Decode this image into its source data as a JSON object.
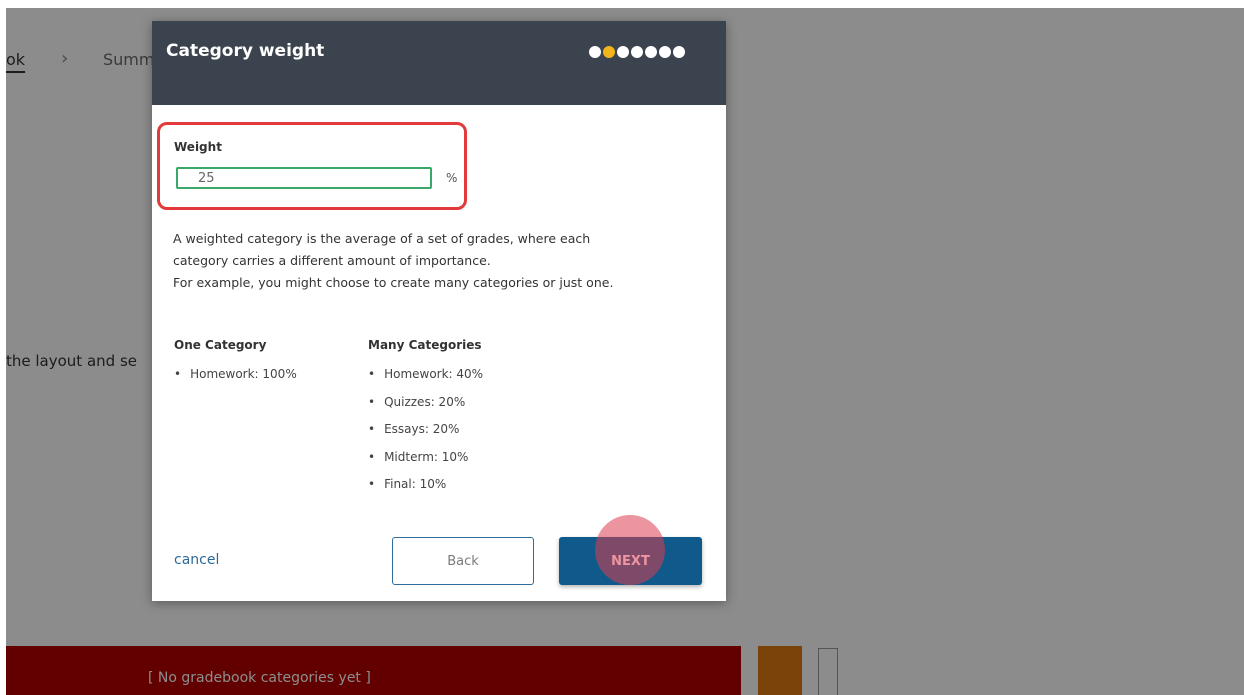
{
  "breadcrumb": {
    "link_label": "ok",
    "separator": "›",
    "current_label": "Summ"
  },
  "background": {
    "instruction_text": "the layout and se",
    "empty_state": "[ No gradebook categories yet ]"
  },
  "modal": {
    "title": "Category weight",
    "progress": {
      "total_steps": 7,
      "current_step": 2
    },
    "weight": {
      "label": "Weight",
      "value": "25",
      "unit": "%"
    },
    "description": [
      "A weighted category is the average of a set of grades, where each",
      "category carries a different amount of importance.",
      "For example, you might choose to create many categories or just one."
    ],
    "one_category": {
      "heading": "One Category",
      "items": [
        "Homework: 100%"
      ]
    },
    "many_categories": {
      "heading": "Many Categories",
      "items": [
        "Homework: 40%",
        "Quizzes: 20%",
        "Essays: 20%",
        "Midterm: 10%",
        "Final: 10%"
      ]
    },
    "cancel_label": "cancel",
    "back_label": "Back",
    "next_label": "NEXT"
  },
  "colors": {
    "header_bg": "#3a434e",
    "active_dot": "#f2b51c",
    "primary_button": "#0f5a8a",
    "highlight_border": "#e23a3a",
    "input_border": "#3aa86a",
    "empty_bar": "#b30000"
  }
}
